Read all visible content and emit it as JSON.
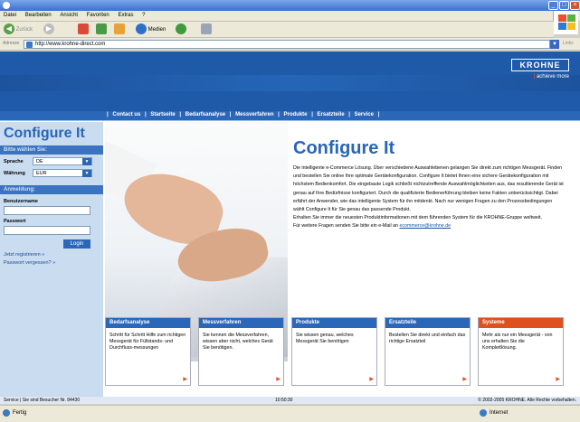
{
  "menu": [
    "Datei",
    "Bearbeiten",
    "Ansicht",
    "Favoriten",
    "Extras",
    "?"
  ],
  "toolbar": {
    "back_label": "Zurück",
    "media_label": "Medien"
  },
  "address": {
    "label": "Adresse",
    "url": "http://www.krohne-direct.com",
    "go_label": "Links"
  },
  "brand": {
    "logo": "KROHNE",
    "tagline": "achieve more"
  },
  "nav": [
    "Contact us",
    "Startseite",
    "Bedarfsanalyse",
    "Messverfahren",
    "Produkte",
    "Ersatzteile",
    "Service"
  ],
  "sidebar": {
    "title": "Configure It",
    "select_heading": "Bitte wählen Sie:",
    "language_label": "Sprache",
    "language_value": "DE",
    "currency_label": "Währung",
    "currency_value": "EUR",
    "login_heading": "Anmeldung:",
    "username_label": "Benutzername",
    "password_label": "Passwort",
    "login_button": "Login",
    "register_link": "Jetzt registrieren »",
    "forgot_link": "Passwort vergessen? »"
  },
  "main": {
    "title": "Configure It",
    "paragraphs": [
      "Die intelligente e-Commerce Lösung. Über verschiedene Auswahlebenen gelangen Sie direkt zum richtigen Messgerät. Finden und bestellen Sie online Ihre optimale Gerätekonfiguration. Configure It bietet Ihnen eine sichere Gerätekonfiguration mit höchstem Bedienkomfort. Die eingebaute Logik schließt nichtzutreffende Auswahlmöglichkeiten aus, das resultierende Gerät ist genau auf Ihre Bedürfnisse konfiguriert. Durch die qualifizierte Bedienerführung bleiben keine Fakten unberücksichtigt. Dabei erfährt der Anwender, wie das intelligente System für ihn mitdenkt. Nach nur wenigen Fragen zu den Prozessbedingungen wählt Configure It für Sie genau das passende Produkt.",
      "Erhalten Sie immer die neuesten Produktinformationen mit dem führenden System für die KROHNE-Gruppe weltweit."
    ],
    "contact_text": "Für weitere Fragen senden Sie bitte ein e-Mail an",
    "contact_email": "ecommerce@krohne.de"
  },
  "cards": [
    {
      "title": "Bedarfsanalyse",
      "text": "Schritt für Schritt Hilfe zum richtigen Messgerät für Füllstands- und Durchfluss-messungen",
      "accent": "#2b67b8"
    },
    {
      "title": "Messverfahren",
      "text": "Sie kennen die Messverfahren, wissen aber nicht, welches Gerät Sie benötigen.",
      "accent": "#2b67b8"
    },
    {
      "title": "Produkte",
      "text": "Sie wissen genau, welches Messgerät Sie benötigen",
      "accent": "#2b67b8"
    },
    {
      "title": "Ersatzteile",
      "text": "Bestellen Sie direkt und einfach das richtige Ersatzteil",
      "accent": "#2b67b8"
    },
    {
      "title": "Systeme",
      "text": "Mehr als nur ein Messgerät - von uns erhalten Sie die Komplettlösung.",
      "accent": "#e0501e"
    }
  ],
  "footer": {
    "left": "Service | Sie sind Besucher Nr. 84430",
    "center": "10:50:30",
    "right": "© 2002-2005 KROHNE. Alle Rechte vorbehalten."
  },
  "status": {
    "left": "Fertig",
    "right": "Internet"
  }
}
